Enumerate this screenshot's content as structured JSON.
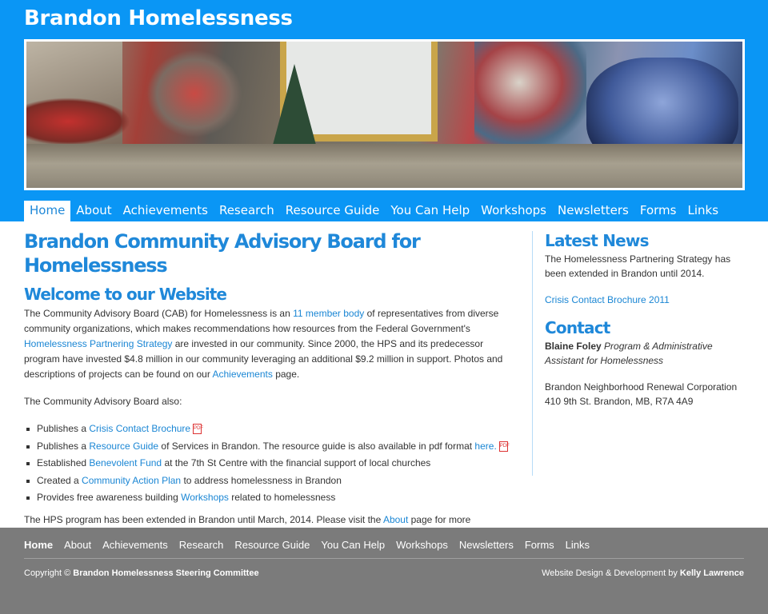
{
  "site": {
    "title": "Brandon Homelessness"
  },
  "nav": {
    "items": [
      {
        "label": "Home",
        "active": true
      },
      {
        "label": "About"
      },
      {
        "label": "Achievements"
      },
      {
        "label": "Research"
      },
      {
        "label": "Resource Guide"
      },
      {
        "label": "You Can Help"
      },
      {
        "label": "Workshops"
      },
      {
        "label": "Newsletters"
      },
      {
        "label": "Forms"
      },
      {
        "label": "Links"
      }
    ]
  },
  "main": {
    "title": "Brandon Community Advisory Board for Homelessness",
    "welcome": "Welcome to our Website",
    "p1": {
      "a": "The Community Advisory Board (CAB) for Homelessness is an ",
      "link1": "11 member body",
      "b": " of representatives from diverse community organizations, which makes recommendations how resources from the Federal Government's ",
      "link2": "Homelessness Partnering Strategy",
      "c": " are invested in our community.  Since 2000, the HPS and its predecessor program have invested $4.8 million in our community leveraging an additional $9.2 million in support. Photos and descriptions of projects can be found on our ",
      "link3": "Achievements",
      "d": " page."
    },
    "also": "The Community Advisory Board also:",
    "list": [
      {
        "pre": "Publishes a ",
        "link": "Crisis Contact Brochure",
        "post": ""
      },
      {
        "pre": "Publishes a ",
        "link": "Resource Guide",
        "post": " of Services in Brandon.  The resource guide is also available in pdf format ",
        "link2": "here."
      },
      {
        "pre": "Established ",
        "link": "Benevolent Fund",
        "post": " at the 7th St Centre with the financial support of local churches"
      },
      {
        "pre": "Created a ",
        "link": "Community Action Plan",
        "post": " to address homelessness in Brandon"
      },
      {
        "pre": "Provides free awareness building ",
        "link": "Workshops",
        "post": " related to homelessness"
      }
    ],
    "p3": {
      "a": "The HPS program has been extended in Brandon until March, 2014. Please visit the ",
      "link": "About",
      "b": " page for more information on the Community Advisory Board."
    }
  },
  "sidebar": {
    "news_title": "Latest News",
    "news_text": "The Homelessness Partnering Strategy has been extended in Brandon until 2014.",
    "news_link": "Crisis Contact Brochure 2011",
    "contact_title": "Contact",
    "contact_name": "Blaine Foley",
    "contact_role": " Program & Administrative Assistant for Homelessness",
    "org": "Brandon Neighborhood Renewal Corporation",
    "address": "410 9th St. Brandon, MB, R7A 4A9"
  },
  "footer": {
    "nav": [
      "Home",
      "About",
      "Achievements",
      "Research",
      "Resource Guide",
      "You Can Help",
      "Workshops",
      "Newsletters",
      "Forms",
      "Links"
    ],
    "copyright_pre": "Copyright © ",
    "copyright_org": "Brandon Homelessness Steering Committee",
    "credit_pre": "Website Design & Development by ",
    "credit_name": "Kelly Lawrence"
  },
  "colors": {
    "header": "#0a96f5",
    "link": "#1a86d4",
    "footer": "#7b7b7b"
  }
}
